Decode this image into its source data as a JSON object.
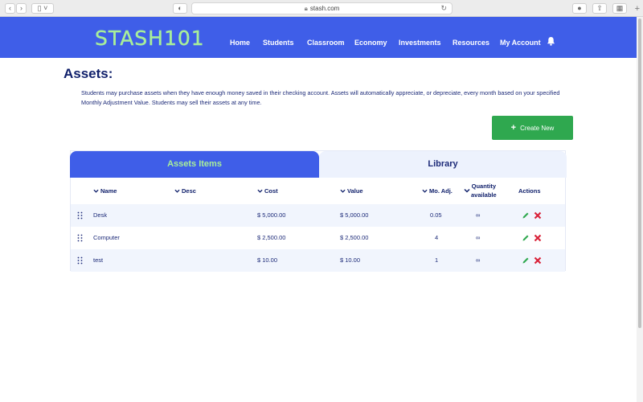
{
  "browser": {
    "url": "stash.com"
  },
  "header": {
    "logo": "STASH101",
    "nav": [
      {
        "label": "Home"
      },
      {
        "label": "Students"
      },
      {
        "label": "Classroom"
      },
      {
        "label": "Economy"
      },
      {
        "label": "Investments"
      },
      {
        "label": "Resources"
      },
      {
        "label": "My Account"
      }
    ]
  },
  "page": {
    "title": "Assets:",
    "description": "Students may purchase assets when they have enough money saved in their checking account. Assets will automatically appreciate, or depreciate, every month based on your specified Monthly Adjustment Value. Students may sell their assets at any time.",
    "create_label": "Create New"
  },
  "tabs": [
    {
      "label": "Assets Items",
      "active": true
    },
    {
      "label": "Library",
      "active": false
    }
  ],
  "table": {
    "headers": {
      "name": "Name",
      "desc": "Desc",
      "cost": "Cost",
      "value": "Value",
      "adj": "Mo. Adj.",
      "qty_line1": "Quantity",
      "qty_line2": "available",
      "actions": "Actions"
    },
    "rows": [
      {
        "name": "Desk",
        "desc": "",
        "cost": "$ 5,000.00",
        "value": "$ 5,000.00",
        "adj": "0.05",
        "qty": "∞"
      },
      {
        "name": "Computer",
        "desc": "",
        "cost": "$ 2,500.00",
        "value": "$ 2,500.00",
        "adj": "4",
        "qty": "∞"
      },
      {
        "name": "test",
        "desc": "",
        "cost": "$ 10.00",
        "value": "$ 10.00",
        "adj": "1",
        "qty": "∞"
      }
    ]
  },
  "colors": {
    "brand_blue": "#3f5ee8",
    "logo_green": "#a8ee9a",
    "button_green": "#2fa84f",
    "delete_red": "#d9233a",
    "edit_green": "#2fa84f"
  }
}
